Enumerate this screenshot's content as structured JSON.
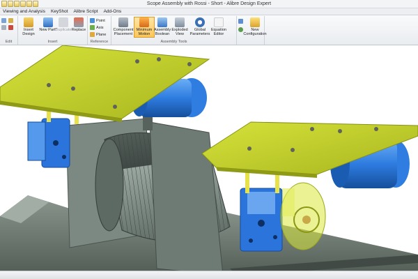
{
  "window": {
    "title": "Scope Assembly with Rossi - Short - Alibre Design Expert"
  },
  "menu": {
    "items": [
      {
        "label": "Viewing and Analysis"
      },
      {
        "label": "KeyShot"
      },
      {
        "label": "Alibre Script"
      },
      {
        "label": "Add-Ons"
      }
    ]
  },
  "ribbon": {
    "groups": {
      "edit": "Edit",
      "insert": "Insert",
      "reference": "Reference",
      "assembly_tools": "Assembly Tools"
    },
    "tools": {
      "insert_design": "Insert Design",
      "new_part": "New Part*",
      "duplicate": "Duplicate",
      "replace": "Replace",
      "point": "Point",
      "axis": "Axis",
      "plane": "Plane",
      "component_placement": "Component Placement",
      "minimum_motion": "Minimum Motion",
      "assembly_boolean": "Assembly Boolean",
      "exploded_view": "Exploded View",
      "global_parameters": "Global Parameters",
      "equation_editor": "Equation Editor",
      "new_configuration": "New Configuration"
    }
  },
  "colors": {
    "plate": "#c3d12c",
    "motor_blue": "#2f7de0",
    "gearbox_blue": "#1f66d6",
    "frame_gray": "#6e7a72",
    "drum_gray": "#74807b",
    "active_tool": "#fbc65a"
  }
}
